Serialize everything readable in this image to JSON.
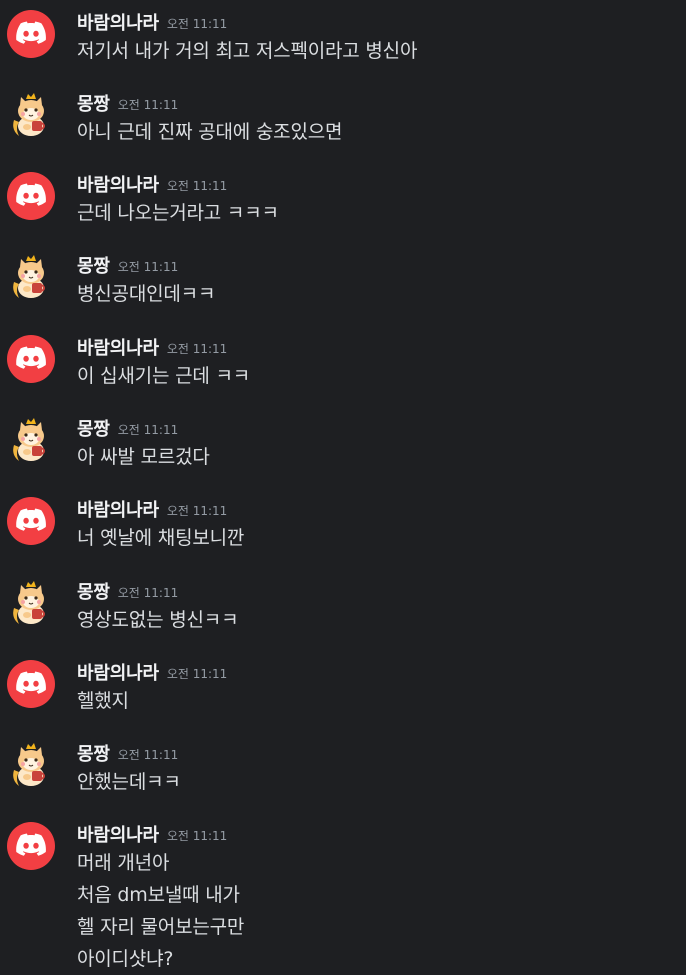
{
  "messages": [
    {
      "author": "바람의나라",
      "avatar": "discord-logo",
      "time": "오전 11:11",
      "lines": [
        "저기서 내가 거의 최고 저스펙이라고 병신아"
      ]
    },
    {
      "author": "몽짱",
      "avatar": "mong-character",
      "time": "오전 11:11",
      "lines": [
        "아니 근데 진짜 공대에 숭조있으면"
      ]
    },
    {
      "author": "바람의나라",
      "avatar": "discord-logo",
      "time": "오전 11:11",
      "lines": [
        "근데 나오는거라고 ㅋㅋㅋ"
      ]
    },
    {
      "author": "몽짱",
      "avatar": "mong-character",
      "time": "오전 11:11",
      "lines": [
        "병신공대인데ㅋㅋ"
      ]
    },
    {
      "author": "바람의나라",
      "avatar": "discord-logo",
      "time": "오전 11:11",
      "lines": [
        "이 십새기는 근데 ㅋㅋ"
      ]
    },
    {
      "author": "몽짱",
      "avatar": "mong-character",
      "time": "오전 11:11",
      "lines": [
        "아 싸발 모르겄다"
      ]
    },
    {
      "author": "바람의나라",
      "avatar": "discord-logo",
      "time": "오전 11:11",
      "lines": [
        "너 옛날에 채팅보니깐"
      ]
    },
    {
      "author": "몽짱",
      "avatar": "mong-character",
      "time": "오전 11:11",
      "lines": [
        "영상도없는 병신ㅋㅋ"
      ]
    },
    {
      "author": "바람의나라",
      "avatar": "discord-logo",
      "time": "오전 11:11",
      "lines": [
        "헬했지"
      ]
    },
    {
      "author": "몽짱",
      "avatar": "mong-character",
      "time": "오전 11:11",
      "lines": [
        "안했는데ㅋㅋ"
      ]
    },
    {
      "author": "바람의나라",
      "avatar": "discord-logo",
      "time": "오전 11:11",
      "lines": [
        "머래 개년아",
        "처음 dm보낼때 내가",
        "헬 자리 물어보는구만",
        "아이디샷냐?"
      ]
    }
  ],
  "colors": {
    "background": "#1e1f22",
    "discord_red": "#f23f43",
    "author": "#f2f3f5",
    "text": "#dbdee1",
    "timestamp": "#949ba4"
  }
}
